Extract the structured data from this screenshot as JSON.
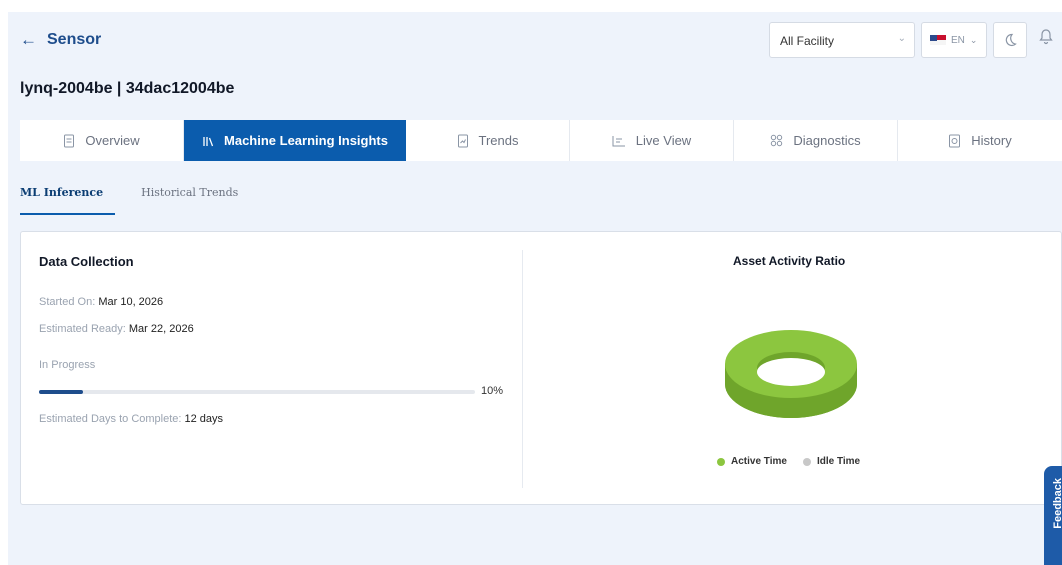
{
  "header": {
    "back_label": "Sensor",
    "facility_selected": "All Facility",
    "language": "EN"
  },
  "device": {
    "title": "lynq-2004be | 34dac12004be"
  },
  "tabs": [
    {
      "label": "Overview",
      "icon": "document-icon"
    },
    {
      "label": "Machine Learning Insights",
      "icon": "bars-icon",
      "active": true
    },
    {
      "label": "Trends",
      "icon": "trend-doc-icon"
    },
    {
      "label": "Live View",
      "icon": "chart-icon"
    },
    {
      "label": "Diagnostics",
      "icon": "grid-icon"
    },
    {
      "label": "History",
      "icon": "history-icon"
    }
  ],
  "subtabs": [
    {
      "label": "ML Inference",
      "active": true
    },
    {
      "label": "Historical Trends"
    }
  ],
  "data_collection": {
    "title": "Data Collection",
    "started_label": "Started On:",
    "started_value": "Mar 10, 2026",
    "ready_label": "Estimated Ready:",
    "ready_value": "Mar 22, 2026",
    "status": "In Progress",
    "progress_percent": 10,
    "progress_text": "10%",
    "days_label": "Estimated Days to Complete:",
    "days_value": "12 days"
  },
  "activity_chart": {
    "title": "Asset Activity Ratio",
    "legend": [
      {
        "label": "Active Time",
        "color": "#8cc63f"
      },
      {
        "label": "Idle Time",
        "color": "#c8c8c8"
      }
    ]
  },
  "feedback_label": "Feedback",
  "colors": {
    "primary": "#0b5cad",
    "accent_green": "#8cc63f",
    "background": "#eef3fb"
  }
}
